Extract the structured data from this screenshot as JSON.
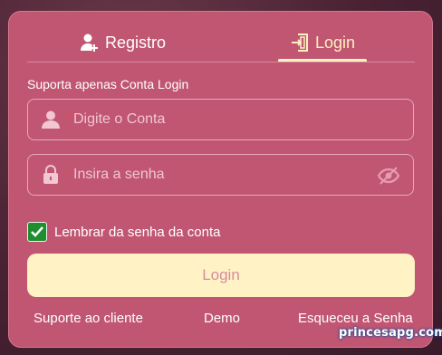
{
  "tabs": [
    {
      "label": "Registro",
      "icon": "user-add-icon"
    },
    {
      "label": "Login",
      "icon": "door-login-icon"
    }
  ],
  "hint": "Suporta apenas Conta Login",
  "account_field": {
    "placeholder": "Digite o Conta",
    "required_mark": "*",
    "icon": "user-icon"
  },
  "password_field": {
    "placeholder": "Insira a senha",
    "required_mark": "*",
    "icon": "lock-icon",
    "toggle_icon": "eye-off-icon"
  },
  "remember": {
    "label": "Lembrar da senha da conta",
    "checked": true
  },
  "login_button": "Login",
  "links": {
    "support": "Suporte ao cliente",
    "demo": "Demo",
    "forgot": "Esqueceu a Senha"
  },
  "watermark": "princesapg.com",
  "colors": {
    "card": "#c05672",
    "accent": "#fff2c4",
    "checkbox": "#1e8e2e"
  }
}
